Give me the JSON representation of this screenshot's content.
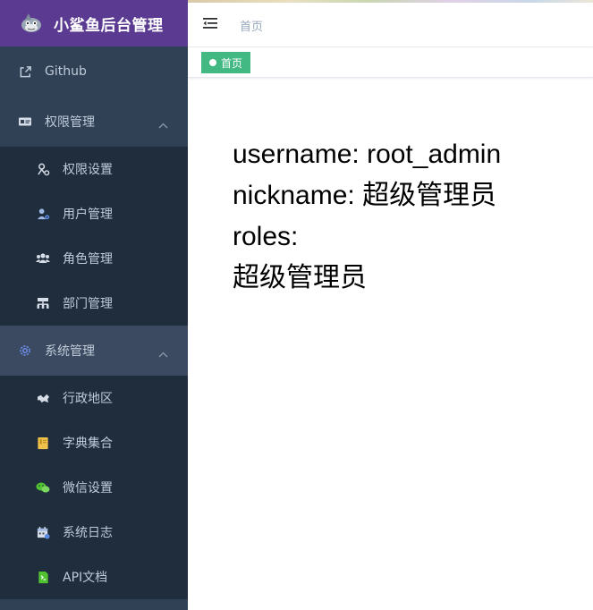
{
  "app": {
    "title": "小鲨鱼后台管理"
  },
  "sidebar": {
    "items": [
      {
        "label": "Github",
        "icon": "external-link-icon"
      },
      {
        "label": "权限管理",
        "icon": "id-card-icon",
        "expanded": true,
        "children": [
          {
            "label": "权限设置",
            "icon": "permission-icon"
          },
          {
            "label": "用户管理",
            "icon": "user-gear-icon"
          },
          {
            "label": "角色管理",
            "icon": "group-icon"
          },
          {
            "label": "部门管理",
            "icon": "org-tree-icon"
          }
        ]
      },
      {
        "label": "系统管理",
        "icon": "gear-icon",
        "expanded": true,
        "children": [
          {
            "label": "行政地区",
            "icon": "region-icon"
          },
          {
            "label": "字典集合",
            "icon": "dictionary-icon"
          },
          {
            "label": "微信设置",
            "icon": "wechat-icon"
          },
          {
            "label": "系统日志",
            "icon": "calendar-log-icon"
          },
          {
            "label": "API文档",
            "icon": "document-icon"
          }
        ]
      }
    ]
  },
  "header": {
    "breadcrumb": "首页"
  },
  "tags": [
    {
      "label": "首页",
      "active": true
    }
  ],
  "main": {
    "username_line": "username: root_admin",
    "nickname_line": "nickname: 超级管理员",
    "roles_line": "roles:",
    "role_value": "超级管理员"
  },
  "colors": {
    "sidebar_bg": "#304156",
    "sidebar_sub_bg": "#1f2d3d",
    "logo_bg": "#5b3a91",
    "tag_active": "#42b983",
    "menu_text": "#bfcbd9"
  }
}
